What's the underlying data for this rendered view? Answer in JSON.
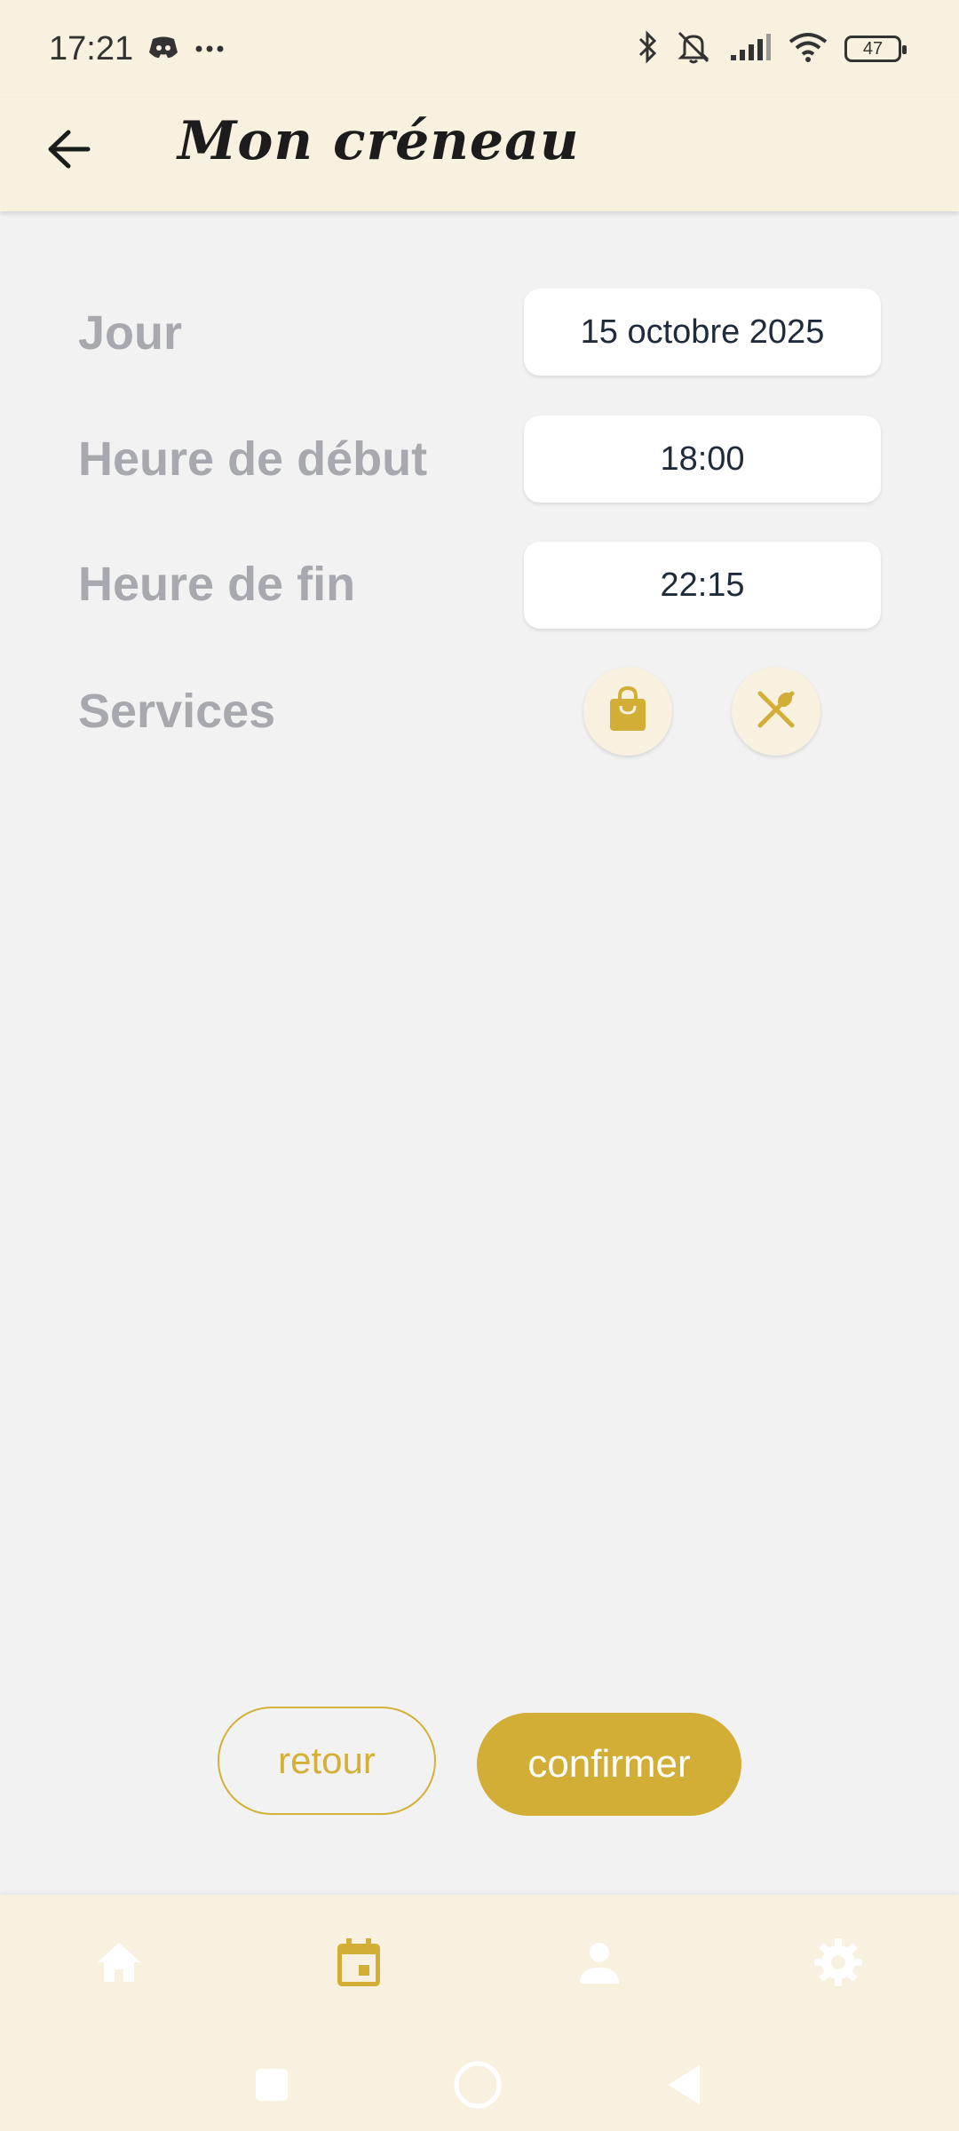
{
  "status_bar": {
    "time": "17:21",
    "battery": "47",
    "icons": [
      "discord-icon",
      "more-dots-icon",
      "bluetooth-icon",
      "mute-icon",
      "signal-icon",
      "wifi-icon",
      "battery-icon"
    ]
  },
  "header": {
    "title": "Mon créneau",
    "back_icon": "arrow-left-icon"
  },
  "form": {
    "day_label": "Jour",
    "day_value": "15 octobre 2025",
    "start_label": "Heure de début",
    "start_value": "18:00",
    "end_label": "Heure de fin",
    "end_value": "22:15",
    "services_label": "Services",
    "services": [
      {
        "icon": "shopping-bag-icon"
      },
      {
        "icon": "restaurant-icon"
      }
    ]
  },
  "actions": {
    "back_label": "retour",
    "confirm_label": "confirmer"
  },
  "nav": {
    "items": [
      {
        "icon": "home-icon",
        "active": false
      },
      {
        "icon": "calendar-icon",
        "active": true
      },
      {
        "icon": "person-icon",
        "active": false
      },
      {
        "icon": "settings-gear-icon",
        "active": false
      }
    ]
  },
  "colors": {
    "accent": "#d3ae36",
    "bar_background": "#f8f1df",
    "page_background": "#f2f2f2",
    "label_gray": "#a7a9ae",
    "inactive_icon": "#ffffff"
  }
}
